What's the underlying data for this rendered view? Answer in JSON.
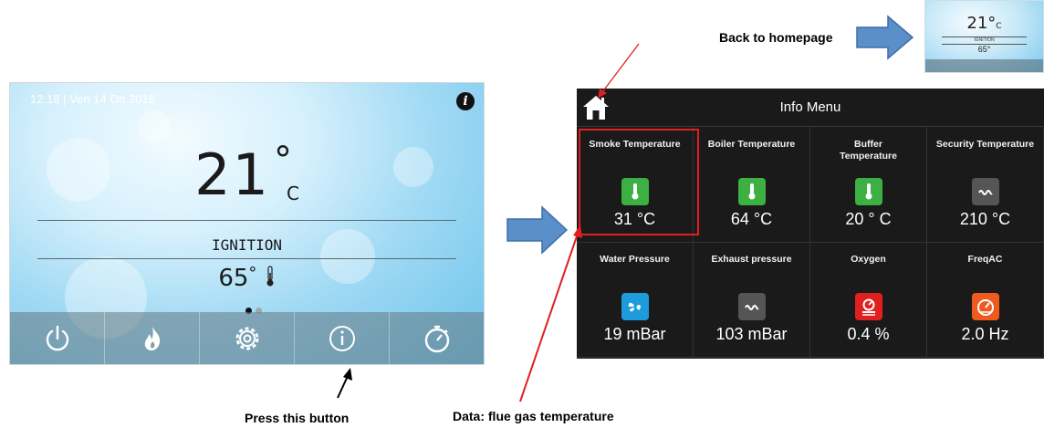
{
  "left_screen": {
    "datetime": "12:18 | Ven 14 Ott 2016",
    "temperature_value": "21",
    "temperature_degree": "°",
    "temperature_unit": "C",
    "status": "IGNITION",
    "setpoint_value": "65",
    "setpoint_degree": "°",
    "page_dots": 2,
    "active_dot": 0,
    "bottom_bar_icons": [
      "power-icon",
      "flame-icon",
      "gear-icon",
      "info-icon",
      "timer-icon"
    ],
    "info_icon": "info-icon"
  },
  "right_screen": {
    "title": "Info Menu",
    "home_icon": "home-icon",
    "cells": [
      {
        "label": "Smoke Temperature",
        "icon": "thermometer-icon",
        "icon_color": "#3cb043",
        "value": "31 °C"
      },
      {
        "label": "Boiler Temperature",
        "icon": "thermometer-icon",
        "icon_color": "#3cb043",
        "value": "64 °C"
      },
      {
        "label": "Buffer Temperature",
        "icon": "thermometer-icon",
        "icon_color": "#3cb043",
        "value": "20 ° C"
      },
      {
        "label": "Security Temperature",
        "icon": "heater-icon",
        "icon_color": "#555555",
        "value": "210 °C"
      },
      {
        "label": "Water Pressure",
        "icon": "fan-icon",
        "icon_color": "#1e9bdc",
        "value": "19 mBar"
      },
      {
        "label": "Exhaust pressure",
        "icon": "heater-icon",
        "icon_color": "#555555",
        "value": "103 mBar"
      },
      {
        "label": "Oxygen",
        "icon": "oxygen-sensor-icon",
        "icon_color": "#e0201e",
        "value": "0.4 %"
      },
      {
        "label": "FreqAC",
        "icon": "gauge-icon",
        "icon_color": "#f05a1e",
        "value": "2.0 Hz"
      }
    ]
  },
  "annotations": {
    "back_to_homepage": "Back to homepage",
    "press_this_button": "Press this button",
    "flue_gas": "Data: flue gas temperature"
  },
  "thumbnail": {
    "temperature": "21°",
    "unit": "C",
    "status": "IGNITION",
    "setpoint": "65°"
  },
  "colors": {
    "arrow_blue": "#5b8fc9",
    "highlight_red": "#e02020",
    "screen_dark": "#1a1a1a"
  }
}
